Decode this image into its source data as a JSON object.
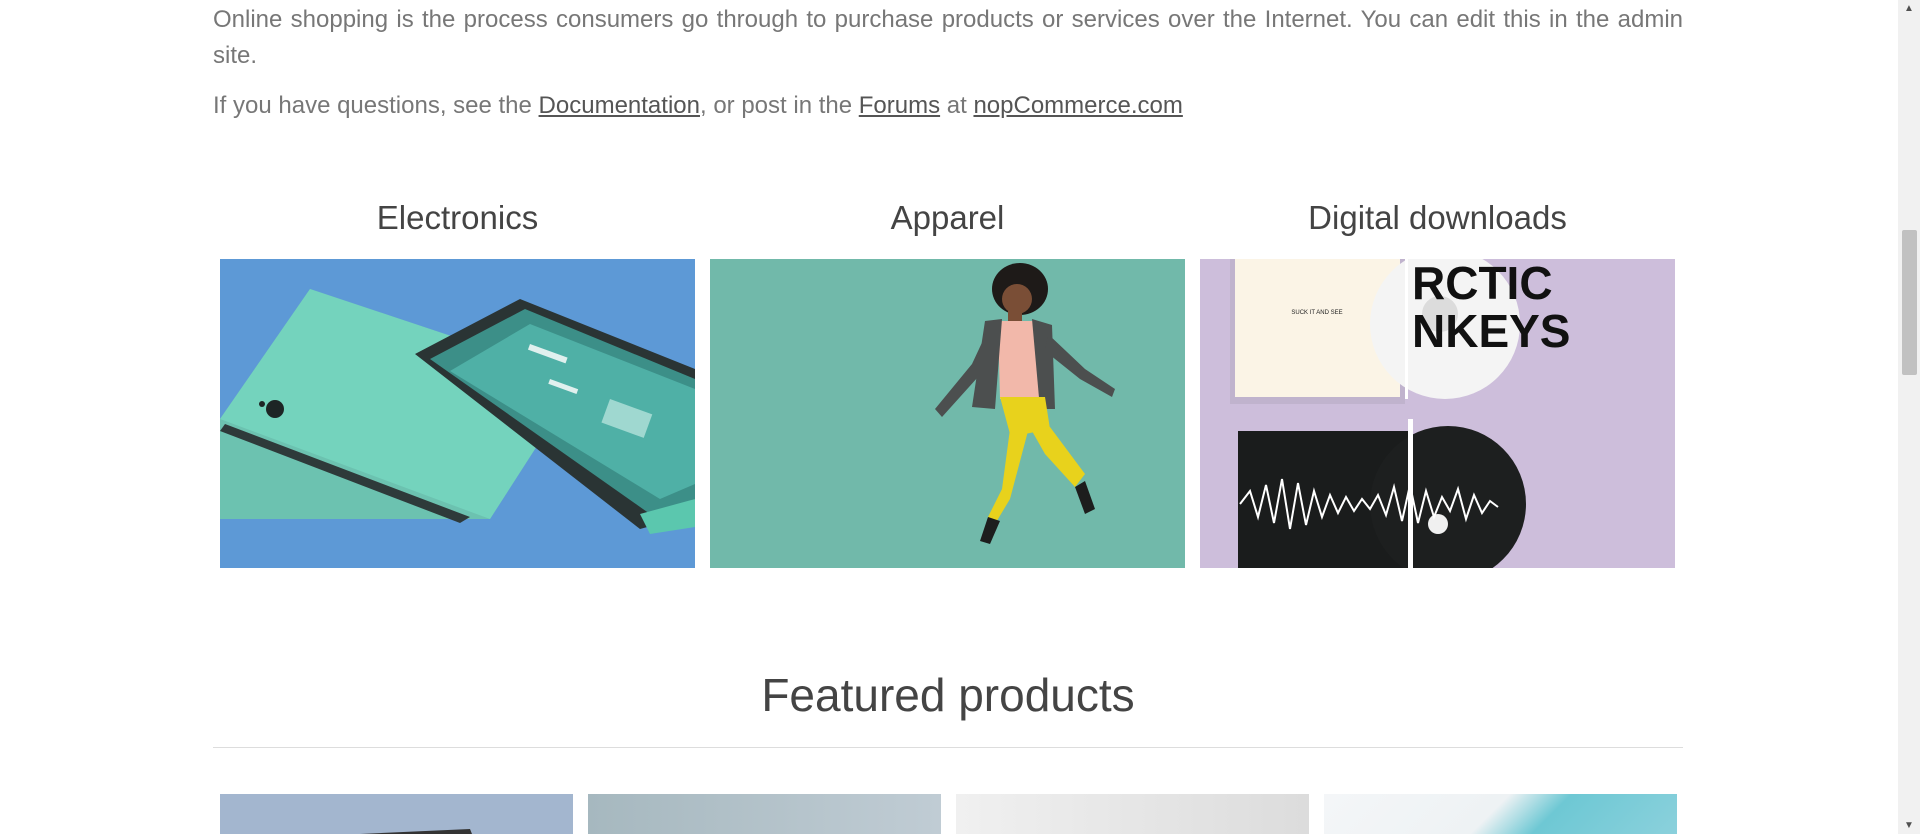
{
  "intro": {
    "paragraph1": "Online shopping is the process consumers go through to purchase products or services over the Internet. You can edit this in the admin site.",
    "q_prefix": "If you have questions, see the ",
    "doc_link": "Documentation",
    "q_middle": ", or post in the ",
    "forums_link": "Forums",
    "q_at": " at ",
    "site_link": "nopCommerce.com"
  },
  "categories": [
    {
      "title": "Electronics",
      "icon": "electronics-image"
    },
    {
      "title": "Apparel",
      "icon": "apparel-image"
    },
    {
      "title": "Digital downloads",
      "icon": "digital-downloads-image"
    }
  ],
  "cd_labels": {
    "album_title": "SUCK IT AND SEE",
    "band_line1": "RCTIC",
    "band_line2": "NKEYS"
  },
  "featured": {
    "title": "Featured products"
  },
  "colors": {
    "electronics_bg": "#5d99d6",
    "apparel_bg": "#71b9aa",
    "digital_bg": "#cdbedb"
  }
}
